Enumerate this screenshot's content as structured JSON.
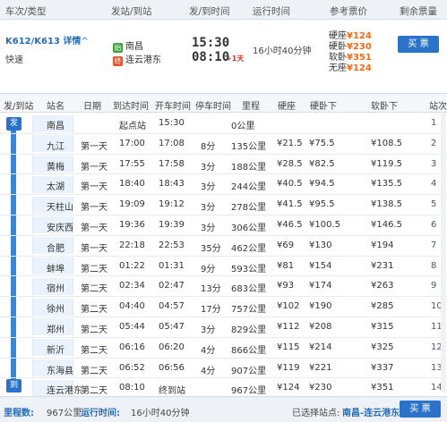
{
  "header": {
    "train_type_col": "车次/类型",
    "from_to_col": "发站/到站",
    "dep_arr_time_col": "发/到时间",
    "duration_col": "运行时间",
    "ref_fare_col": "参考票价",
    "remaining_col": "剩余票量"
  },
  "train": {
    "number": "K612/K613",
    "detail_label": "详情",
    "type": "快速",
    "origin": "南昌",
    "destination": "连云港东",
    "origin_icon_text": "始",
    "dest_icon_text": "终",
    "departure": "15:30",
    "arrival": "08:10",
    "next_day": "+1天",
    "duration": "16小时40分钟",
    "fares": [
      {
        "label": "硬座",
        "price": "¥124"
      },
      {
        "label": "硬卧",
        "price": "¥230"
      },
      {
        "label": "软卧",
        "price": "¥351"
      },
      {
        "label": "无座",
        "price": "¥124"
      }
    ],
    "buy_label": "买 票"
  },
  "stops_table": {
    "columns": [
      "发/到站",
      "站名",
      "日期",
      "到达时间",
      "开车时间",
      "停车时间",
      "里程",
      "硬座",
      "硬卧下",
      "软卧下",
      "站次"
    ],
    "start_badge": "发",
    "end_badge": "到",
    "rows": [
      {
        "station": "南昌",
        "day": "",
        "arrive": "起点站",
        "depart": "15:30",
        "stop": "",
        "km": "0公里",
        "yz": "",
        "yw": "",
        "rw": "",
        "seq": "1"
      },
      {
        "station": "九江",
        "day": "第一天",
        "arrive": "17:00",
        "depart": "17:08",
        "stop": "8分",
        "km": "135公里",
        "yz": "¥21.5",
        "yw": "¥75.5",
        "rw": "¥108.5",
        "seq": "2"
      },
      {
        "station": "黄梅",
        "day": "第一天",
        "arrive": "17:55",
        "depart": "17:58",
        "stop": "3分",
        "km": "188公里",
        "yz": "¥28.5",
        "yw": "¥82.5",
        "rw": "¥119.5",
        "seq": "3"
      },
      {
        "station": "太湖",
        "day": "第一天",
        "arrive": "18:40",
        "depart": "18:43",
        "stop": "3分",
        "km": "244公里",
        "yz": "¥40.5",
        "yw": "¥94.5",
        "rw": "¥135.5",
        "seq": "4"
      },
      {
        "station": "天柱山",
        "day": "第一天",
        "arrive": "19:09",
        "depart": "19:12",
        "stop": "3分",
        "km": "278公里",
        "yz": "¥41.5",
        "yw": "¥95.5",
        "rw": "¥138.5",
        "seq": "5"
      },
      {
        "station": "安庆西",
        "day": "第一天",
        "arrive": "19:36",
        "depart": "19:39",
        "stop": "3分",
        "km": "306公里",
        "yz": "¥46.5",
        "yw": "¥100.5",
        "rw": "¥146.5",
        "seq": "6"
      },
      {
        "station": "合肥",
        "day": "第一天",
        "arrive": "22:18",
        "depart": "22:53",
        "stop": "35分",
        "km": "462公里",
        "yz": "¥69",
        "yw": "¥130",
        "rw": "¥194",
        "seq": "7"
      },
      {
        "station": "蚌埠",
        "day": "第二天",
        "arrive": "01:22",
        "depart": "01:31",
        "stop": "9分",
        "km": "593公里",
        "yz": "¥81",
        "yw": "¥154",
        "rw": "¥231",
        "seq": "8"
      },
      {
        "station": "宿州",
        "day": "第二天",
        "arrive": "02:34",
        "depart": "02:47",
        "stop": "13分",
        "km": "683公里",
        "yz": "¥93",
        "yw": "¥174",
        "rw": "¥263",
        "seq": "9"
      },
      {
        "station": "徐州",
        "day": "第二天",
        "arrive": "04:40",
        "depart": "04:57",
        "stop": "17分",
        "km": "757公里",
        "yz": "¥102",
        "yw": "¥190",
        "rw": "¥285",
        "seq": "10"
      },
      {
        "station": "郑州",
        "day": "第二天",
        "arrive": "05:44",
        "depart": "05:47",
        "stop": "3分",
        "km": "829公里",
        "yz": "¥112",
        "yw": "¥208",
        "rw": "¥315",
        "seq": "11"
      },
      {
        "station": "新沂",
        "day": "第二天",
        "arrive": "06:16",
        "depart": "06:20",
        "stop": "4分",
        "km": "866公里",
        "yz": "¥115",
        "yw": "¥214",
        "rw": "¥325",
        "seq": "12"
      },
      {
        "station": "东海县",
        "day": "第二天",
        "arrive": "06:52",
        "depart": "06:56",
        "stop": "4分",
        "km": "907公里",
        "yz": "¥119",
        "yw": "¥221",
        "rw": "¥337",
        "seq": "13"
      },
      {
        "station": "连云港东",
        "day": "第二天",
        "arrive": "08:10",
        "depart": "终到站",
        "stop": "",
        "km": "967公里",
        "yz": "¥124",
        "yw": "¥230",
        "rw": "¥351",
        "seq": "14"
      }
    ]
  },
  "footer": {
    "distance_label": "里程数:",
    "distance_value": "967公里",
    "time_label": "运行时间:",
    "time_value": "16小时40分钟",
    "selected_label": "已选择站点:",
    "selected_value": "南昌-连云港东",
    "buy_label": "买 票"
  }
}
